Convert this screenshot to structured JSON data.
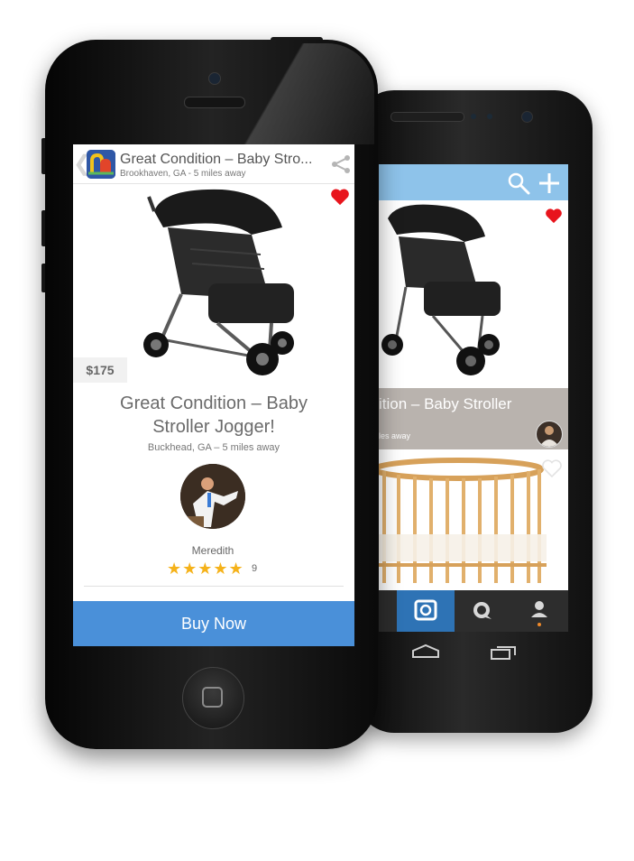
{
  "front_screen": {
    "header": {
      "title": "Great Condition – Baby Stro...",
      "location": "Brookhaven, GA - 5 miles away",
      "back_glyph": "❮"
    },
    "listing": {
      "price": "$175",
      "title": "Great Condition – Baby Stroller Jogger!",
      "location": "Buckhead, GA – 5 miles away",
      "seller_name": "Meredith",
      "stars": "★★★★★",
      "rating_count": "9",
      "favorited": true
    },
    "buy_button": "Buy Now",
    "icons": [
      "back-icon",
      "app-icon",
      "share-icon",
      "heart-icon"
    ]
  },
  "back_screen": {
    "top_icons": [
      "search-icon",
      "plus-icon"
    ],
    "card1": {
      "title": "ition – Baby Stroller",
      "location": "les away",
      "favorited": true
    },
    "card2": {
      "favorited": false
    },
    "nav_tabs": [
      "camera-tab-icon",
      "chat-tab-icon",
      "profile-tab-icon"
    ]
  },
  "colors": {
    "buy_button": "#4a90d9",
    "back_topbar": "#8ec3ea",
    "heart": "#e8141c",
    "stars": "#f5b21a",
    "active_tab": "#2e73b5"
  }
}
